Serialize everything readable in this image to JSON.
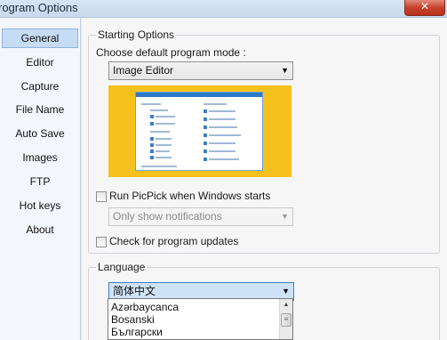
{
  "window": {
    "title": "rogram Options",
    "close_glyph": "✕"
  },
  "sidebar": {
    "items": [
      {
        "label": "General",
        "active": true
      },
      {
        "label": "Editor"
      },
      {
        "label": "Capture"
      },
      {
        "label": "File Name"
      },
      {
        "label": "Auto Save"
      },
      {
        "label": "Images"
      },
      {
        "label": "FTP"
      },
      {
        "label": "Hot keys"
      },
      {
        "label": "About"
      }
    ]
  },
  "starting_options": {
    "legend": "Starting Options",
    "mode_label": "Choose default program mode :",
    "mode_value": "Image Editor",
    "run_on_start_label": "Run PicPick when Windows starts",
    "run_on_start_checked": false,
    "notify_value": "Only show notifications",
    "check_updates_label": "Check for program updates",
    "check_updates_checked": false
  },
  "language": {
    "legend": "Language",
    "selected": "简体中文",
    "options": [
      "Azərbaycanca",
      "Bosanski",
      "Български"
    ]
  },
  "icons": {
    "dropdown_arrow": "▼",
    "scroll_up": "▲",
    "scroll_grip": "≡"
  },
  "colors": {
    "preview_background": "#f7c11d",
    "sidebar_active": "#c6dcf5",
    "close_button": "#c8432d"
  }
}
